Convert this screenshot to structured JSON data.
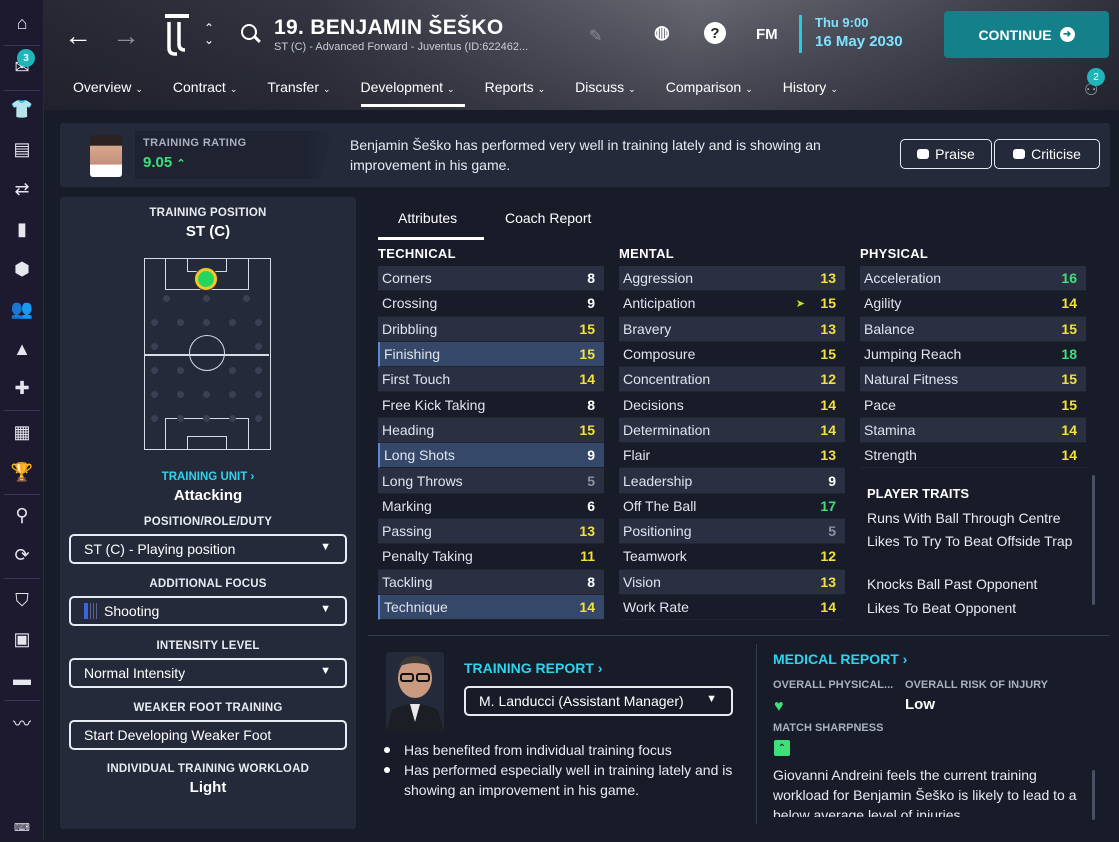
{
  "sidebar": {
    "inbox_badge": "3",
    "icons": [
      "home-icon",
      "inbox-icon",
      "squad-icon",
      "tactics-icon",
      "transfers-icon",
      "scouting-icon",
      "club-icon",
      "staff-icon",
      "training-icon",
      "medical-icon",
      "schedule-icon",
      "competitions-icon",
      "search-icon",
      "sync-icon",
      "club-vision-icon",
      "finances-icon",
      "contracts-icon",
      "dev-centre-icon",
      "keyboard-icon"
    ]
  },
  "header": {
    "player_name": "19. BENJAMIN ŠEŠKO",
    "player_subtitle": "ST (C) - Advanced Forward - Juventus (ID:622462...",
    "fm_label": "FM",
    "date_time": "Thu 9:00",
    "date": "16 May 2030",
    "continue_label": "CONTINUE",
    "notifications_badge": "2",
    "tabs": [
      {
        "label": "Overview"
      },
      {
        "label": "Contract"
      },
      {
        "label": "Transfer"
      },
      {
        "label": "Development"
      },
      {
        "label": "Reports"
      },
      {
        "label": "Discuss"
      },
      {
        "label": "Comparison"
      },
      {
        "label": "History"
      }
    ]
  },
  "rating": {
    "label": "TRAINING RATING",
    "value": "9.05",
    "trend_icon": "arrow-up",
    "text": "Benjamin Šeško has performed very well in training lately and is showing an improvement in his game.",
    "praise_label": "Praise",
    "criticise_label": "Criticise"
  },
  "left": {
    "training_position_label": "TRAINING POSITION",
    "training_position_value": "ST (C)",
    "training_unit_label": "TRAINING UNIT",
    "training_unit_value": "Attacking",
    "role_label": "POSITION/ROLE/DUTY",
    "role_value": "ST (C) - Playing position",
    "focus_label": "ADDITIONAL FOCUS",
    "focus_value": "Shooting",
    "intensity_label": "INTENSITY LEVEL",
    "intensity_value": "Normal Intensity",
    "weak_foot_label": "WEAKER FOOT TRAINING",
    "weak_foot_value": "Start Developing Weaker Foot",
    "workload_label": "INDIVIDUAL TRAINING WORKLOAD",
    "workload_value": "Light"
  },
  "main": {
    "tab_attributes": "Attributes",
    "tab_coach_report": "Coach Report",
    "technical_title": "TECHNICAL",
    "mental_title": "MENTAL",
    "physical_title": "PHYSICAL",
    "technical": [
      {
        "name": "Corners",
        "value": "8",
        "color": "white"
      },
      {
        "name": "Crossing",
        "value": "9",
        "color": "white"
      },
      {
        "name": "Dribbling",
        "value": "15",
        "color": "yellow"
      },
      {
        "name": "Finishing",
        "value": "15",
        "color": "yellow",
        "highlight": true
      },
      {
        "name": "First Touch",
        "value": "14",
        "color": "yellow"
      },
      {
        "name": "Free Kick Taking",
        "value": "8",
        "color": "white"
      },
      {
        "name": "Heading",
        "value": "15",
        "color": "yellow"
      },
      {
        "name": "Long Shots",
        "value": "9",
        "color": "white",
        "highlight": true
      },
      {
        "name": "Long Throws",
        "value": "5",
        "color": "grey"
      },
      {
        "name": "Marking",
        "value": "6",
        "color": "white"
      },
      {
        "name": "Passing",
        "value": "13",
        "color": "yellow"
      },
      {
        "name": "Penalty Taking",
        "value": "11",
        "color": "yellow"
      },
      {
        "name": "Tackling",
        "value": "8",
        "color": "white"
      },
      {
        "name": "Technique",
        "value": "14",
        "color": "yellow",
        "highlight": true
      }
    ],
    "mental": [
      {
        "name": "Aggression",
        "value": "13",
        "color": "yellow"
      },
      {
        "name": "Anticipation",
        "value": "15",
        "color": "yellow",
        "ant": true
      },
      {
        "name": "Bravery",
        "value": "13",
        "color": "yellow"
      },
      {
        "name": "Composure",
        "value": "15",
        "color": "yellow"
      },
      {
        "name": "Concentration",
        "value": "12",
        "color": "yellow"
      },
      {
        "name": "Decisions",
        "value": "14",
        "color": "yellow"
      },
      {
        "name": "Determination",
        "value": "14",
        "color": "yellow"
      },
      {
        "name": "Flair",
        "value": "13",
        "color": "yellow"
      },
      {
        "name": "Leadership",
        "value": "9",
        "color": "white"
      },
      {
        "name": "Off The Ball",
        "value": "17",
        "color": "green"
      },
      {
        "name": "Positioning",
        "value": "5",
        "color": "grey"
      },
      {
        "name": "Teamwork",
        "value": "12",
        "color": "yellow"
      },
      {
        "name": "Vision",
        "value": "13",
        "color": "yellow"
      },
      {
        "name": "Work Rate",
        "value": "14",
        "color": "yellow"
      }
    ],
    "physical": [
      {
        "name": "Acceleration",
        "value": "16",
        "color": "green"
      },
      {
        "name": "Agility",
        "value": "14",
        "color": "yellow"
      },
      {
        "name": "Balance",
        "value": "15",
        "color": "yellow"
      },
      {
        "name": "Jumping Reach",
        "value": "18",
        "color": "green"
      },
      {
        "name": "Natural Fitness",
        "value": "15",
        "color": "yellow"
      },
      {
        "name": "Pace",
        "value": "15",
        "color": "yellow"
      },
      {
        "name": "Stamina",
        "value": "14",
        "color": "yellow"
      },
      {
        "name": "Strength",
        "value": "14",
        "color": "yellow"
      }
    ],
    "traits_title": "PLAYER TRAITS",
    "traits": [
      "Runs With Ball Through Centre",
      "Likes To Try To Beat Offside Trap",
      "Knocks Ball Past Opponent",
      "Likes To Beat Opponent"
    ],
    "training_report_label": "TRAINING REPORT",
    "coach_select": "M. Landucci (Assistant Manager)",
    "bullets": [
      "Has benefited from individual training focus",
      "Has performed especially well in training lately and is showing an improvement in his game."
    ],
    "medical_report_label": "MEDICAL REPORT",
    "overall_physical_label": "OVERALL PHYSICAL...",
    "overall_risk_label": "OVERALL RISK OF INJURY",
    "overall_risk_value": "Low",
    "match_sharpness_label": "MATCH SHARPNESS",
    "medical_text": "Giovanni Andreini feels the current training workload for Benjamin Šeško is likely to lead to a below average level of injuries."
  },
  "colors": {
    "accent": "#1fcfe0",
    "continue": "#14808a",
    "attr_yellow": "#f2e23a",
    "attr_green": "#3fe07a",
    "attr_grey": "#8d92a0"
  }
}
